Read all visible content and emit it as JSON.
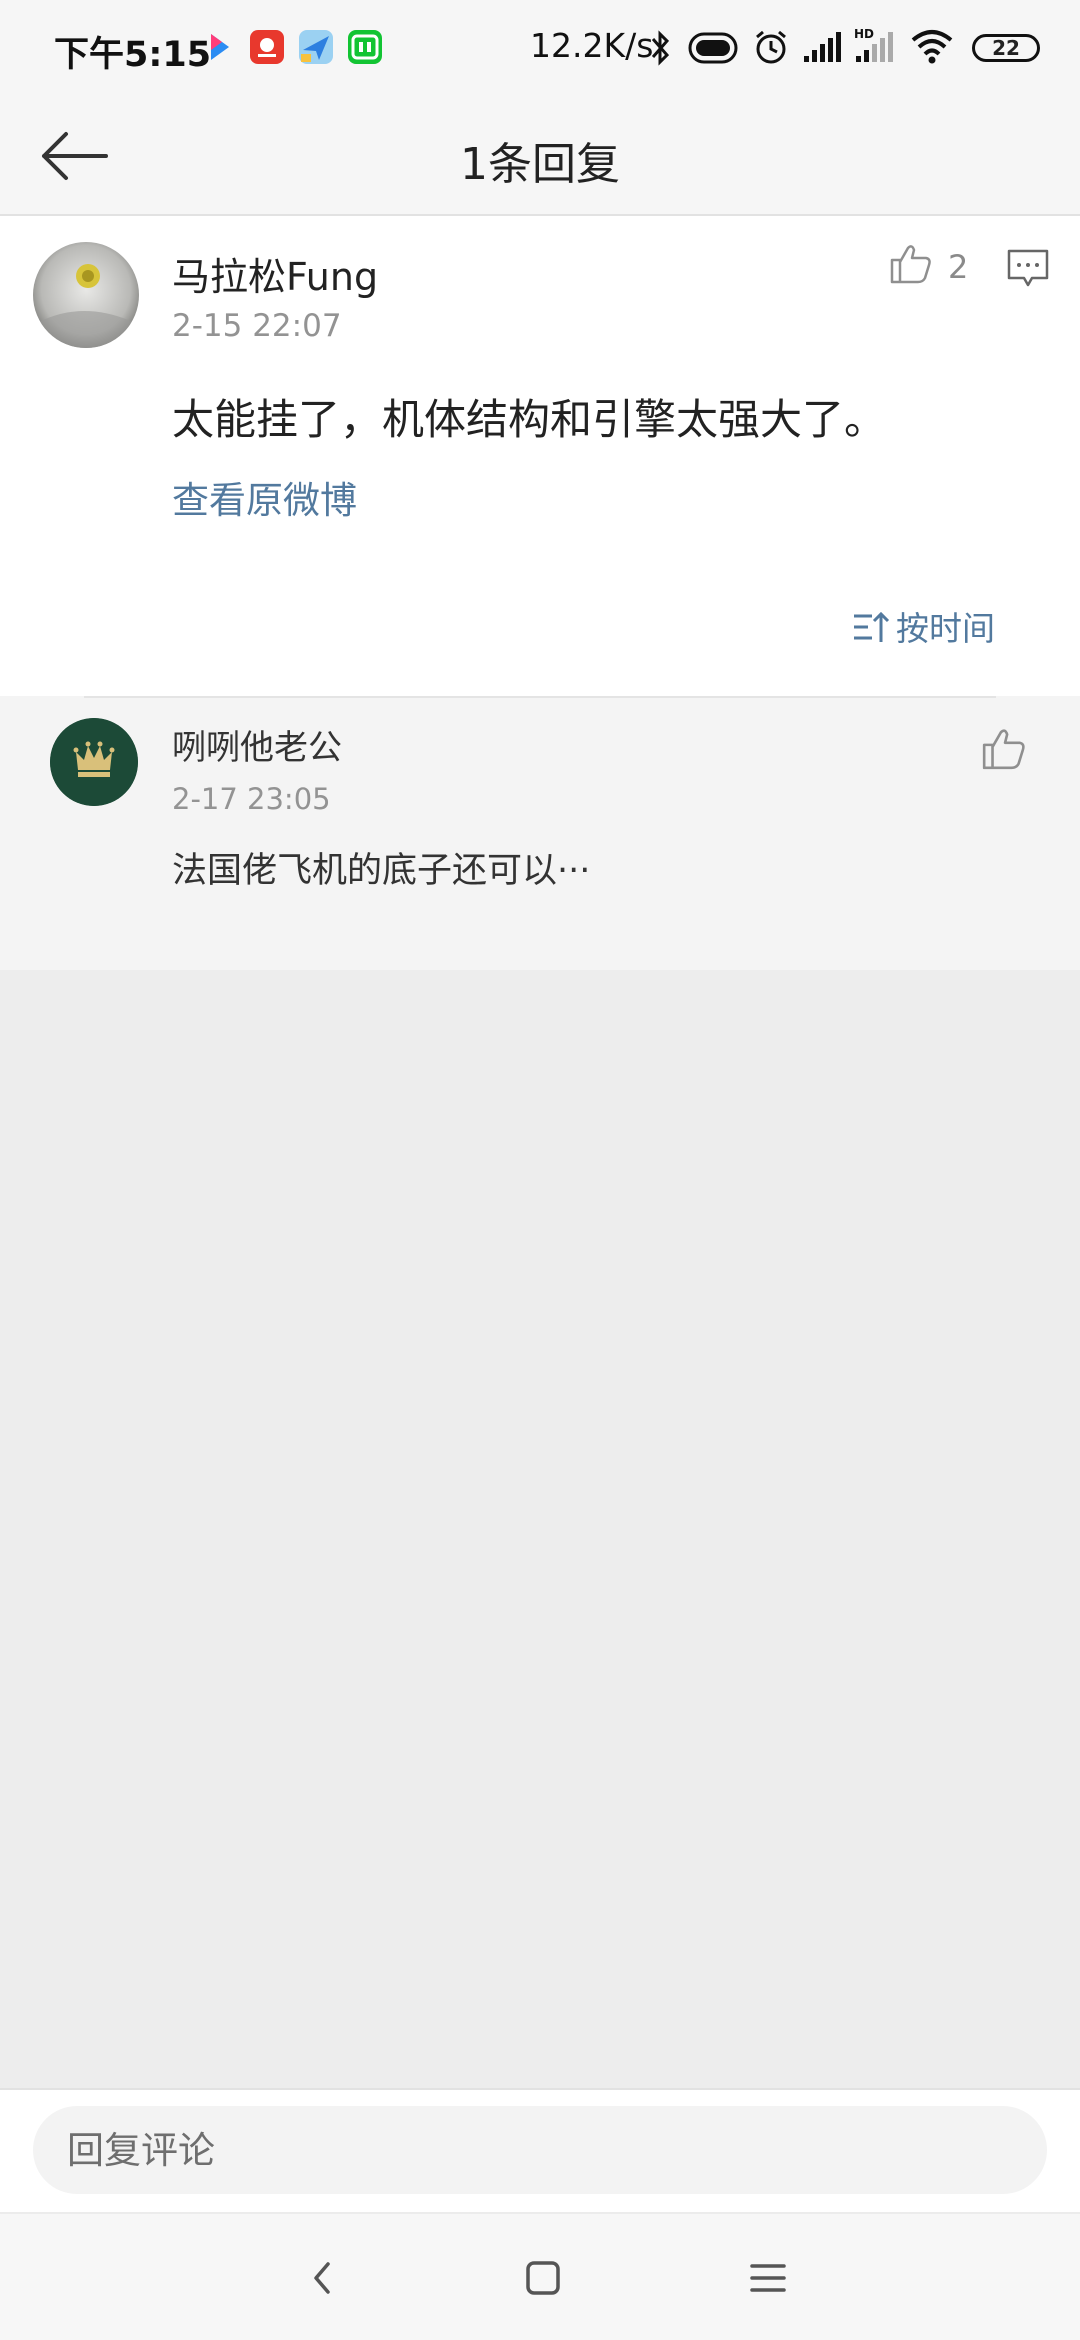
{
  "status_bar": {
    "time": "下午5:15",
    "network_speed": "12.2K/s",
    "battery_level": "22",
    "icons": [
      "youku-icon",
      "app-icon-red",
      "maps-icon",
      "iqiyi-icon",
      "bluetooth-icon",
      "toggle-icon",
      "alarm-icon",
      "signal-icon",
      "hd-signal-icon",
      "wifi-icon"
    ]
  },
  "header": {
    "title": "1条回复"
  },
  "main_comment": {
    "author": "马拉松Fung",
    "time": "2-15 22:07",
    "text": "太能挂了，机体结构和引擎太强大了。",
    "link_text": "查看原微博",
    "like_count": "2",
    "sort_label": "按时间"
  },
  "replies": [
    {
      "author": "咧咧他老公",
      "time": "2-17 23:05",
      "text": "法国佬飞机的底子还可以···"
    }
  ],
  "input_bar": {
    "placeholder": "回复评论"
  },
  "colors": {
    "link": "#52799e",
    "meta_gray": "#939393",
    "page_bg": "#ededed"
  }
}
